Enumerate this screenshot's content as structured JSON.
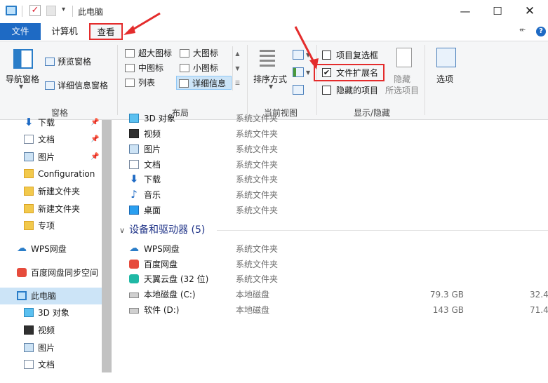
{
  "titlebar": {
    "title": "此电脑",
    "dropdown_glyph": "▾",
    "check_glyph": "✓",
    "minimize": "—",
    "maximize": "☐",
    "close": "✕"
  },
  "tabs": {
    "file": "文件",
    "computer": "计算机",
    "view": "查看"
  },
  "ribbon_controls": {
    "expand_glyph": "↞",
    "help_glyph": "?"
  },
  "ribbon": {
    "panes": {
      "group_label": "窗格",
      "nav_pane": "导航窗格",
      "preview_pane": "预览窗格",
      "details_pane": "详细信息窗格"
    },
    "layout": {
      "group_label": "布局",
      "extra_large": "超大图标",
      "large": "大图标",
      "medium": "中图标",
      "small": "小图标",
      "list": "列表",
      "details": "详细信息"
    },
    "current_view": {
      "group_label": "当前视图",
      "sort_by": "排序方式"
    },
    "show_hide": {
      "group_label": "显示/隐藏",
      "item_checkboxes": "项目复选框",
      "item_checkboxes_checked": false,
      "file_extensions": "文件扩展名",
      "file_extensions_checked": true,
      "hidden_items": "隐藏的项目",
      "hidden_items_checked": false,
      "hide": "隐藏",
      "hide_selected": "所选项目",
      "options": "选项"
    }
  },
  "nav_pane_items": [
    {
      "label": "下载",
      "icon": "download-icon",
      "pinned": true
    },
    {
      "label": "文档",
      "icon": "document-icon",
      "pinned": true
    },
    {
      "label": "图片",
      "icon": "picture-icon",
      "pinned": true
    },
    {
      "label": "Configuration",
      "icon": "folder-icon",
      "pinned": false
    },
    {
      "label": "新建文件夹",
      "icon": "folder-icon",
      "pinned": false
    },
    {
      "label": "新建文件夹",
      "icon": "folder-icon",
      "pinned": false
    },
    {
      "label": "专项",
      "icon": "folder-icon",
      "pinned": false
    },
    {
      "label": "WPS网盘",
      "icon": "cloud-icon",
      "pinned": false
    },
    {
      "label": "百度网盘同步空间",
      "icon": "baidu-netdisk-icon",
      "pinned": false
    },
    {
      "label": "此电脑",
      "icon": "this-pc-icon",
      "pinned": false,
      "selected": true
    },
    {
      "label": "3D 对象",
      "icon": "3d-objects-icon",
      "pinned": false
    },
    {
      "label": "视频",
      "icon": "video-icon",
      "pinned": false
    },
    {
      "label": "图片",
      "icon": "picture-icon",
      "pinned": false
    },
    {
      "label": "文档",
      "icon": "document-icon",
      "pinned": false
    }
  ],
  "pin_glyph": "📌",
  "folders": [
    {
      "name": "3D 对象",
      "type": "系统文件夹",
      "icon": "3d-objects-icon"
    },
    {
      "name": "视频",
      "type": "系统文件夹",
      "icon": "video-icon"
    },
    {
      "name": "图片",
      "type": "系统文件夹",
      "icon": "picture-icon"
    },
    {
      "name": "文档",
      "type": "系统文件夹",
      "icon": "document-icon"
    },
    {
      "name": "下载",
      "type": "系统文件夹",
      "icon": "download-icon"
    },
    {
      "name": "音乐",
      "type": "系统文件夹",
      "icon": "music-icon"
    },
    {
      "name": "桌面",
      "type": "系统文件夹",
      "icon": "desktop-icon"
    }
  ],
  "devices_group": {
    "title": "设备和驱动器",
    "count": "(5)",
    "chevron": "∨"
  },
  "devices": [
    {
      "name": "WPS网盘",
      "type": "系统文件夹",
      "free": "",
      "total": "",
      "icon": "cloud-icon"
    },
    {
      "name": "百度网盘",
      "type": "系统文件夹",
      "free": "",
      "total": "",
      "icon": "baidu-netdisk-icon"
    },
    {
      "name": "天翼云盘 (32 位)",
      "type": "系统文件夹",
      "free": "",
      "total": "",
      "icon": "tianyi-cloud-icon"
    },
    {
      "name": "本地磁盘 (C:)",
      "type": "本地磁盘",
      "free": "79.3 GB",
      "total": "32.4",
      "icon": "windows-drive-icon"
    },
    {
      "name": "软件 (D:)",
      "type": "本地磁盘",
      "free": "143 GB",
      "total": "71.4",
      "icon": "drive-icon"
    }
  ],
  "colors": {
    "accent": "#1e6ac4",
    "highlight_box": "#e42c2c",
    "selection": "#cce4f7"
  }
}
